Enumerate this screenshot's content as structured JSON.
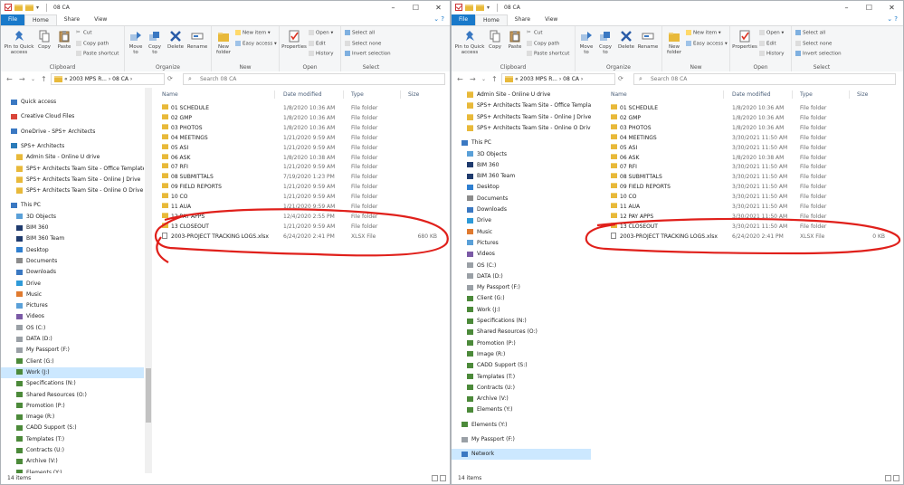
{
  "windows": [
    {
      "id": "left",
      "title": "08 CA",
      "tabs": [
        "File",
        "Home",
        "Share",
        "View"
      ],
      "ribbon": {
        "clipboard": {
          "pin": "Pin to Quick access",
          "copy": "Copy",
          "paste": "Paste",
          "cut": "Cut",
          "copy_path": "Copy path",
          "paste_shortcut": "Paste shortcut",
          "label": "Clipboard"
        },
        "organize": {
          "move_to": "Move to",
          "copy_to": "Copy to",
          "delete": "Delete",
          "rename": "Rename",
          "label": "Organize"
        },
        "new": {
          "new_folder": "New folder",
          "new_item": "New item",
          "easy_access": "Easy access",
          "label": "New"
        },
        "open": {
          "properties": "Properties",
          "open": "Open",
          "edit": "Edit",
          "history": "History",
          "label": "Open"
        },
        "select": {
          "select_all": "Select all",
          "select_none": "Select none",
          "invert": "Invert selection",
          "label": "Select"
        }
      },
      "address": "« 2003 MPS R... › 08 CA ›",
      "search_placeholder": "Search 08 CA",
      "columns": {
        "name": "Name",
        "date": "Date modified",
        "type": "Type",
        "size": "Size"
      },
      "nav": [
        {
          "label": "Quick access",
          "icon": "star-icon",
          "selected": false
        },
        {
          "label": "Creative Cloud Files",
          "icon": "cloud-icon",
          "selected": false
        },
        {
          "label": "OneDrive - SPS+ Architects",
          "icon": "onedrive-icon",
          "selected": false
        },
        {
          "label": "SPS+ Architects",
          "icon": "sharepoint-icon",
          "selected": false
        },
        {
          "label": "Admin Site - Online U drive",
          "icon": "folder-icon",
          "selected": false
        },
        {
          "label": "SPS+ Architects Team Site - Office Templates",
          "icon": "folder-icon",
          "selected": false
        },
        {
          "label": "SPS+ Architects Team Site - Online J Drive",
          "icon": "folder-icon",
          "selected": false
        },
        {
          "label": "SPS+ Architects Team Site - Online O Drive",
          "icon": "folder-icon",
          "selected": false
        },
        {
          "label": "This PC",
          "icon": "computer-icon",
          "selected": false
        },
        {
          "label": "3D Objects",
          "icon": "cube-icon",
          "selected": false
        },
        {
          "label": "BIM 360",
          "icon": "bim-icon",
          "selected": false
        },
        {
          "label": "BIM 360 Team",
          "icon": "bim-icon",
          "selected": false
        },
        {
          "label": "Desktop",
          "icon": "desktop-icon",
          "selected": false
        },
        {
          "label": "Documents",
          "icon": "documents-icon",
          "selected": false
        },
        {
          "label": "Downloads",
          "icon": "download-icon",
          "selected": false
        },
        {
          "label": "Drive",
          "icon": "drive-icon",
          "selected": false
        },
        {
          "label": "Music",
          "icon": "music-icon",
          "selected": false
        },
        {
          "label": "Pictures",
          "icon": "pictures-icon",
          "selected": false
        },
        {
          "label": "Videos",
          "icon": "videos-icon",
          "selected": false
        },
        {
          "label": "OS (C:)",
          "icon": "disk-icon",
          "selected": false
        },
        {
          "label": "DATA (D:)",
          "icon": "disk-icon",
          "selected": false
        },
        {
          "label": "My Passport (F:)",
          "icon": "disk-icon",
          "selected": false
        },
        {
          "label": "Client (G:)",
          "icon": "network-drive-icon",
          "selected": false
        },
        {
          "label": "Work (J:)",
          "icon": "network-drive-icon",
          "selected": true
        },
        {
          "label": "Specifications (N:)",
          "icon": "network-drive-icon",
          "selected": false
        },
        {
          "label": "Shared Resources (O:)",
          "icon": "network-drive-icon",
          "selected": false
        },
        {
          "label": "Promotion (P:)",
          "icon": "network-drive-icon",
          "selected": false
        },
        {
          "label": "Image (R:)",
          "icon": "network-drive-icon",
          "selected": false
        },
        {
          "label": "CADD Support (S:)",
          "icon": "network-drive-icon",
          "selected": false
        },
        {
          "label": "Templates (T:)",
          "icon": "network-drive-icon",
          "selected": false
        },
        {
          "label": "Contracts (U:)",
          "icon": "network-drive-icon",
          "selected": false
        },
        {
          "label": "Archive (V:)",
          "icon": "network-drive-icon",
          "selected": false
        },
        {
          "label": "Elements (Y:)",
          "icon": "network-drive-icon",
          "selected": false
        }
      ],
      "files": [
        {
          "name": "01 SCHEDULE",
          "date": "1/8/2020 10:36 AM",
          "type": "File folder",
          "size": "",
          "kind": "folder"
        },
        {
          "name": "02 GMP",
          "date": "1/8/2020 10:36 AM",
          "type": "File folder",
          "size": "",
          "kind": "folder"
        },
        {
          "name": "03 PHOTOS",
          "date": "1/8/2020 10:36 AM",
          "type": "File folder",
          "size": "",
          "kind": "folder"
        },
        {
          "name": "04 MEETINGS",
          "date": "1/21/2020 9:59 AM",
          "type": "File folder",
          "size": "",
          "kind": "folder"
        },
        {
          "name": "05 ASI",
          "date": "1/21/2020 9:59 AM",
          "type": "File folder",
          "size": "",
          "kind": "folder"
        },
        {
          "name": "06 ASK",
          "date": "1/8/2020 10:38 AM",
          "type": "File folder",
          "size": "",
          "kind": "folder"
        },
        {
          "name": "07 RFI",
          "date": "1/21/2020 9:59 AM",
          "type": "File folder",
          "size": "",
          "kind": "folder"
        },
        {
          "name": "08 SUBMITTALS",
          "date": "7/19/2020 1:23 PM",
          "type": "File folder",
          "size": "",
          "kind": "folder"
        },
        {
          "name": "09 FIELD REPORTS",
          "date": "1/21/2020 9:59 AM",
          "type": "File folder",
          "size": "",
          "kind": "folder"
        },
        {
          "name": "10 CO",
          "date": "1/21/2020 9:59 AM",
          "type": "File folder",
          "size": "",
          "kind": "folder"
        },
        {
          "name": "11 AUA",
          "date": "1/21/2020 9:59 AM",
          "type": "File folder",
          "size": "",
          "kind": "folder"
        },
        {
          "name": "12 PAY APPS",
          "date": "12/4/2020 2:55 PM",
          "type": "File folder",
          "size": "",
          "kind": "folder"
        },
        {
          "name": "13 CLOSEOUT",
          "date": "1/21/2020 9:59 AM",
          "type": "File folder",
          "size": "",
          "kind": "folder"
        },
        {
          "name": "2003-PROJECT TRACKING LOGS.xlsx",
          "date": "6/24/2020 2:41 PM",
          "type": "XLSX File",
          "size": "680 KB",
          "kind": "file"
        }
      ],
      "status": "14 items"
    },
    {
      "id": "right",
      "title": "08 CA",
      "tabs": [
        "File",
        "Home",
        "Share",
        "View"
      ],
      "ribbon": {
        "clipboard": {
          "pin": "Pin to Quick access",
          "copy": "Copy",
          "paste": "Paste",
          "cut": "Cut",
          "copy_path": "Copy path",
          "paste_shortcut": "Paste shortcut",
          "label": "Clipboard"
        },
        "organize": {
          "move_to": "Move to",
          "copy_to": "Copy to",
          "delete": "Delete",
          "rename": "Rename",
          "label": "Organize"
        },
        "new": {
          "new_folder": "New folder",
          "new_item": "New item",
          "easy_access": "Easy access",
          "label": "New"
        },
        "open": {
          "properties": "Properties",
          "open": "Open",
          "edit": "Edit",
          "history": "History",
          "label": "Open"
        },
        "select": {
          "select_all": "Select all",
          "select_none": "Select none",
          "invert": "Invert selection",
          "label": "Select"
        }
      },
      "address": "« 2003 MPS R... › 08 CA ›",
      "search_placeholder": "Search 08 CA",
      "columns": {
        "name": "Name",
        "date": "Date modified",
        "type": "Type",
        "size": "Size"
      },
      "nav": [
        {
          "label": "Admin Site - Online U drive",
          "icon": "folder-icon",
          "selected": false
        },
        {
          "label": "SPS+ Architects Team Site - Office Templates",
          "icon": "folder-icon",
          "selected": false
        },
        {
          "label": "SPS+ Architects Team Site - Online J Drive",
          "icon": "folder-icon",
          "selected": false
        },
        {
          "label": "SPS+ Architects Team Site - Online O Drive",
          "icon": "folder-icon",
          "selected": false
        },
        {
          "label": "This PC",
          "icon": "computer-icon",
          "selected": false
        },
        {
          "label": "3D Objects",
          "icon": "cube-icon",
          "selected": false
        },
        {
          "label": "BIM 360",
          "icon": "bim-icon",
          "selected": false
        },
        {
          "label": "BIM 360 Team",
          "icon": "bim-icon",
          "selected": false
        },
        {
          "label": "Desktop",
          "icon": "desktop-icon",
          "selected": false
        },
        {
          "label": "Documents",
          "icon": "documents-icon",
          "selected": false
        },
        {
          "label": "Downloads",
          "icon": "download-icon",
          "selected": false
        },
        {
          "label": "Drive",
          "icon": "drive-icon",
          "selected": false
        },
        {
          "label": "Music",
          "icon": "music-icon",
          "selected": false
        },
        {
          "label": "Pictures",
          "icon": "pictures-icon",
          "selected": false
        },
        {
          "label": "Videos",
          "icon": "videos-icon",
          "selected": false
        },
        {
          "label": "OS (C:)",
          "icon": "disk-icon",
          "selected": false
        },
        {
          "label": "DATA (D:)",
          "icon": "disk-icon",
          "selected": false
        },
        {
          "label": "My Passport (F:)",
          "icon": "disk-icon",
          "selected": false
        },
        {
          "label": "Client (G:)",
          "icon": "network-drive-icon",
          "selected": false
        },
        {
          "label": "Work (J:)",
          "icon": "network-drive-icon",
          "selected": false
        },
        {
          "label": "Specifications (N:)",
          "icon": "network-drive-icon",
          "selected": false
        },
        {
          "label": "Shared Resources (O:)",
          "icon": "network-drive-icon",
          "selected": false
        },
        {
          "label": "Promotion (P:)",
          "icon": "network-drive-icon",
          "selected": false
        },
        {
          "label": "Image (R:)",
          "icon": "network-drive-icon",
          "selected": false
        },
        {
          "label": "CADD Support (S:)",
          "icon": "network-drive-icon",
          "selected": false
        },
        {
          "label": "Templates (T:)",
          "icon": "network-drive-icon",
          "selected": false
        },
        {
          "label": "Contracts (U:)",
          "icon": "network-drive-icon",
          "selected": false
        },
        {
          "label": "Archive (V:)",
          "icon": "network-drive-icon",
          "selected": false
        },
        {
          "label": "Elements (Y:)",
          "icon": "network-drive-icon",
          "selected": false
        },
        {
          "label": "Elements (Y:)",
          "icon": "network-drive-icon",
          "selected": false
        },
        {
          "label": "My Passport (F:)",
          "icon": "disk-icon",
          "selected": false
        },
        {
          "label": "Network",
          "icon": "network-icon",
          "selected": true
        }
      ],
      "files": [
        {
          "name": "01 SCHEDULE",
          "date": "1/8/2020 10:36 AM",
          "type": "File folder",
          "size": "",
          "kind": "folder"
        },
        {
          "name": "02 GMP",
          "date": "1/8/2020 10:36 AM",
          "type": "File folder",
          "size": "",
          "kind": "folder"
        },
        {
          "name": "03 PHOTOS",
          "date": "1/8/2020 10:36 AM",
          "type": "File folder",
          "size": "",
          "kind": "folder"
        },
        {
          "name": "04 MEETINGS",
          "date": "3/30/2021 11:50 AM",
          "type": "File folder",
          "size": "",
          "kind": "folder"
        },
        {
          "name": "05 ASI",
          "date": "3/30/2021 11:50 AM",
          "type": "File folder",
          "size": "",
          "kind": "folder"
        },
        {
          "name": "06 ASK",
          "date": "1/8/2020 10:38 AM",
          "type": "File folder",
          "size": "",
          "kind": "folder"
        },
        {
          "name": "07 RFI",
          "date": "3/30/2021 11:50 AM",
          "type": "File folder",
          "size": "",
          "kind": "folder"
        },
        {
          "name": "08 SUBMITTALS",
          "date": "3/30/2021 11:50 AM",
          "type": "File folder",
          "size": "",
          "kind": "folder"
        },
        {
          "name": "09 FIELD REPORTS",
          "date": "3/30/2021 11:50 AM",
          "type": "File folder",
          "size": "",
          "kind": "folder"
        },
        {
          "name": "10 CO",
          "date": "3/30/2021 11:50 AM",
          "type": "File folder",
          "size": "",
          "kind": "folder"
        },
        {
          "name": "11 AUA",
          "date": "3/30/2021 11:50 AM",
          "type": "File folder",
          "size": "",
          "kind": "folder"
        },
        {
          "name": "12 PAY APPS",
          "date": "3/30/2021 11:50 AM",
          "type": "File folder",
          "size": "",
          "kind": "folder"
        },
        {
          "name": "13 CLOSEOUT",
          "date": "3/30/2021 11:50 AM",
          "type": "File folder",
          "size": "",
          "kind": "folder"
        },
        {
          "name": "2003-PROJECT TRACKING LOGS.xlsx",
          "date": "6/24/2020 2:41 PM",
          "type": "XLSX File",
          "size": "0 KB",
          "kind": "file"
        }
      ],
      "status": "14 items"
    }
  ],
  "colors": {
    "file_tab": "#1979ca",
    "selected_nav": "#cce8ff",
    "annotation": "#e0201b",
    "folder": "#e8b93a"
  }
}
